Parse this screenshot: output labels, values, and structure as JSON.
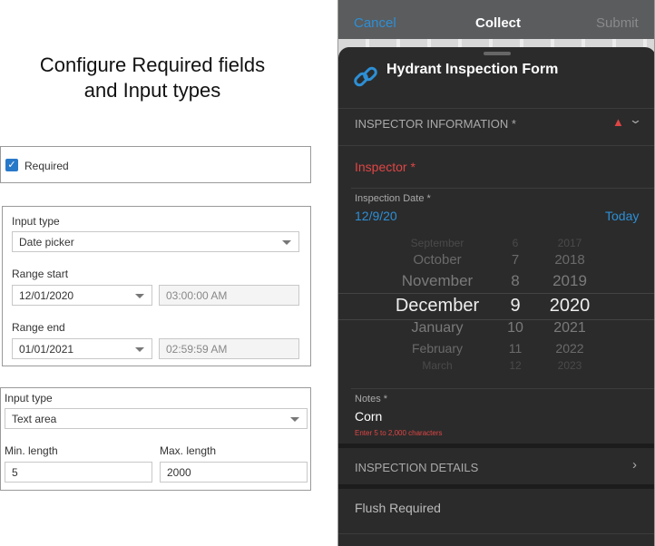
{
  "config": {
    "title_line1": "Configure Required fields",
    "title_line2": "and Input types",
    "required": {
      "label": "Required",
      "checked": true
    },
    "date": {
      "input_type_label": "Input type",
      "input_type": "Date picker",
      "range_start_label": "Range start",
      "range_start_date": "12/01/2020",
      "range_start_time": "03:00:00 AM",
      "range_end_label": "Range end",
      "range_end_date": "01/01/2021",
      "range_end_time": "02:59:59 AM"
    },
    "text": {
      "input_type_label": "Input type",
      "input_type": "Text area",
      "min_label": "Min. length",
      "min": "5",
      "max_label": "Max. length",
      "max": "2000"
    }
  },
  "phone": {
    "cancel": "Cancel",
    "title": "Collect",
    "submit": "Submit",
    "form_title": "Hydrant Inspection Form",
    "section1": "INSPECTOR INFORMATION *",
    "inspector": "Inspector *",
    "date_label": "Inspection Date *",
    "date_value": "12/9/20",
    "today": "Today",
    "picker": {
      "months": [
        "September",
        "October",
        "November",
        "December",
        "January",
        "February",
        "March"
      ],
      "days": [
        "6",
        "7",
        "8",
        "9",
        "10",
        "11",
        "12"
      ],
      "years": [
        "2017",
        "2018",
        "2019",
        "2020",
        "2021",
        "2022",
        "2023"
      ]
    },
    "notes_label": "Notes *",
    "notes_value": "Corn",
    "notes_error": "Enter 5 to 2,000 characters",
    "section2": "INSPECTION DETAILS",
    "flush": "Flush Required",
    "colors": {
      "accent": "#2d8fd5",
      "error": "#e04545"
    }
  }
}
